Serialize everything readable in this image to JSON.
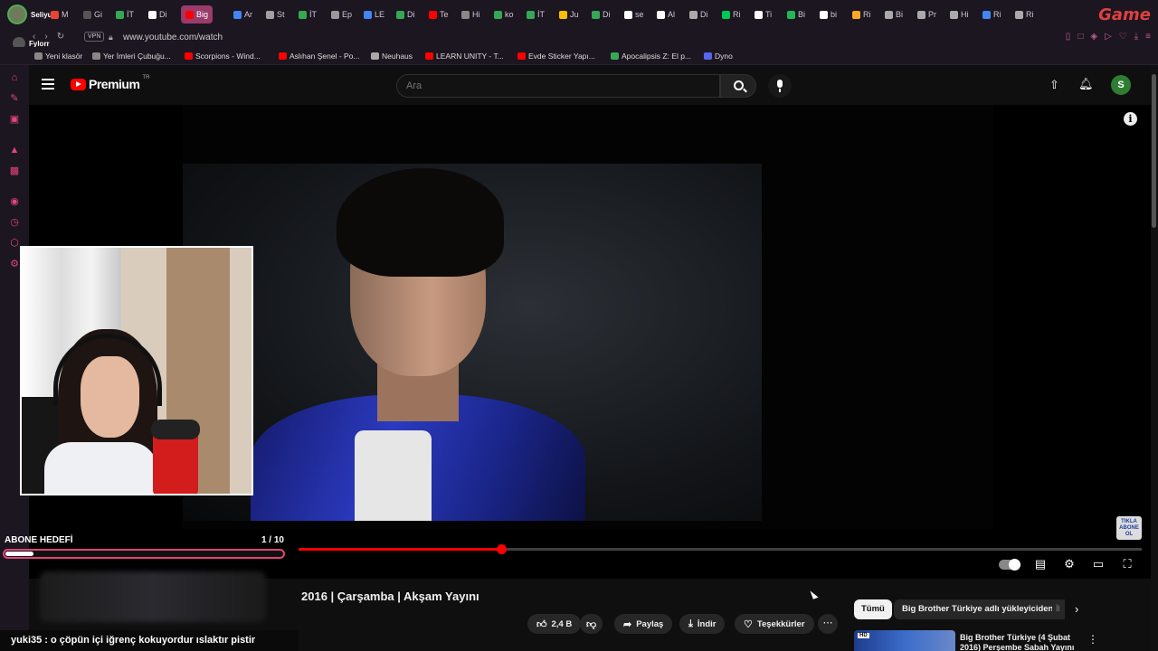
{
  "browser": {
    "streamer_name": "Seliyuki",
    "channel_label": "Fylorr",
    "tabs": [
      {
        "label": "M",
        "color": "#ea4335"
      },
      {
        "label": "Gi",
        "color": "#555555"
      },
      {
        "label": "İT",
        "color": "#34a853"
      },
      {
        "label": "Di",
        "color": "#ffffff"
      },
      {
        "label": "Big",
        "color": "#ff0000"
      },
      {
        "label": "Ar",
        "color": "#4285f4"
      },
      {
        "label": "St",
        "color": "#a0a0a0"
      },
      {
        "label": "İT",
        "color": "#34a853"
      },
      {
        "label": "Ep",
        "color": "#999999"
      },
      {
        "label": "LE",
        "color": "#4285f4"
      },
      {
        "label": "Di",
        "color": "#34a853"
      },
      {
        "label": "Te",
        "color": "#ff0000"
      },
      {
        "label": "Hi",
        "color": "#888888"
      },
      {
        "label": "ko",
        "color": "#34a853"
      },
      {
        "label": "İT",
        "color": "#34a853"
      },
      {
        "label": "Ju",
        "color": "#fbbc05"
      },
      {
        "label": "Di",
        "color": "#34a853"
      },
      {
        "label": "se",
        "color": "#ffffff"
      },
      {
        "label": "Al",
        "color": "#ffffff"
      },
      {
        "label": "Di",
        "color": "#aaaaaa"
      },
      {
        "label": "Ri",
        "color": "#00c853"
      },
      {
        "label": "Ti",
        "color": "#ffffff"
      },
      {
        "label": "Bi",
        "color": "#1db954"
      },
      {
        "label": "bi",
        "color": "#ffffff"
      },
      {
        "label": "Ri",
        "color": "#f9a825"
      },
      {
        "label": "Bi",
        "color": "#aaaaaa"
      },
      {
        "label": "Pr",
        "color": "#aaaaaa"
      },
      {
        "label": "Hi",
        "color": "#aaaaaa"
      },
      {
        "label": "Ri",
        "color": "#4285f4"
      },
      {
        "label": "Ri",
        "color": "#aaaaaa"
      }
    ],
    "active_tab": "Big",
    "brand_logo": "Game",
    "vpn_label": "VPN",
    "url": "www.youtube.com/watch",
    "bookmarks": [
      {
        "label": "Yeni klasör",
        "color": "#888888"
      },
      {
        "label": "Yer İmleri Çubuğu...",
        "color": "#888888"
      },
      {
        "label": "Scorpions - Wind...",
        "color": "#ff0000"
      },
      {
        "label": "Aslıhan Şenel - Po...",
        "color": "#ff0000"
      },
      {
        "label": "Neuhaus",
        "color": "#aaaaaa"
      },
      {
        "label": "LEARN UNITY - T...",
        "color": "#ff0000"
      },
      {
        "label": "Evde Sticker Yapı...",
        "color": "#ff0000"
      },
      {
        "label": "Apocalipsis Z: El p...",
        "color": "#3aa757"
      },
      {
        "label": "Dyno",
        "color": "#5865f2"
      }
    ]
  },
  "youtube": {
    "logo_text": "Premium",
    "logo_sup": "TR",
    "search_placeholder": "Ara",
    "avatar_letter": "S",
    "video": {
      "progress_fraction": 0.24,
      "title": "2016 | Çarşamba | Akşam Yayını",
      "subscribe_badge": "TIKLA ABONE OL"
    },
    "actions": {
      "likes": "2,4 B",
      "share": "Paylaş",
      "download": "İndir",
      "thanks": "Teşekkürler"
    },
    "chips": {
      "all": "Tümü",
      "uploader": "Big Brother Türkiye adlı yükleyiciden",
      "more": "İl"
    },
    "recommended": {
      "hd_badge": "HD",
      "title": "Big Brother Türkiye (4 Şubat 2016) Perşembe Sabah Yayını"
    }
  },
  "stream_overlay": {
    "sub_goal_label": "ABONE HEDEFİ",
    "sub_goal_count": "1  / 10",
    "sub_goal_fraction": 0.1,
    "chat_user": "yuki35",
    "chat_message": " : o çöpün içi iğrenç kokuyordur ıslaktır pistir"
  }
}
